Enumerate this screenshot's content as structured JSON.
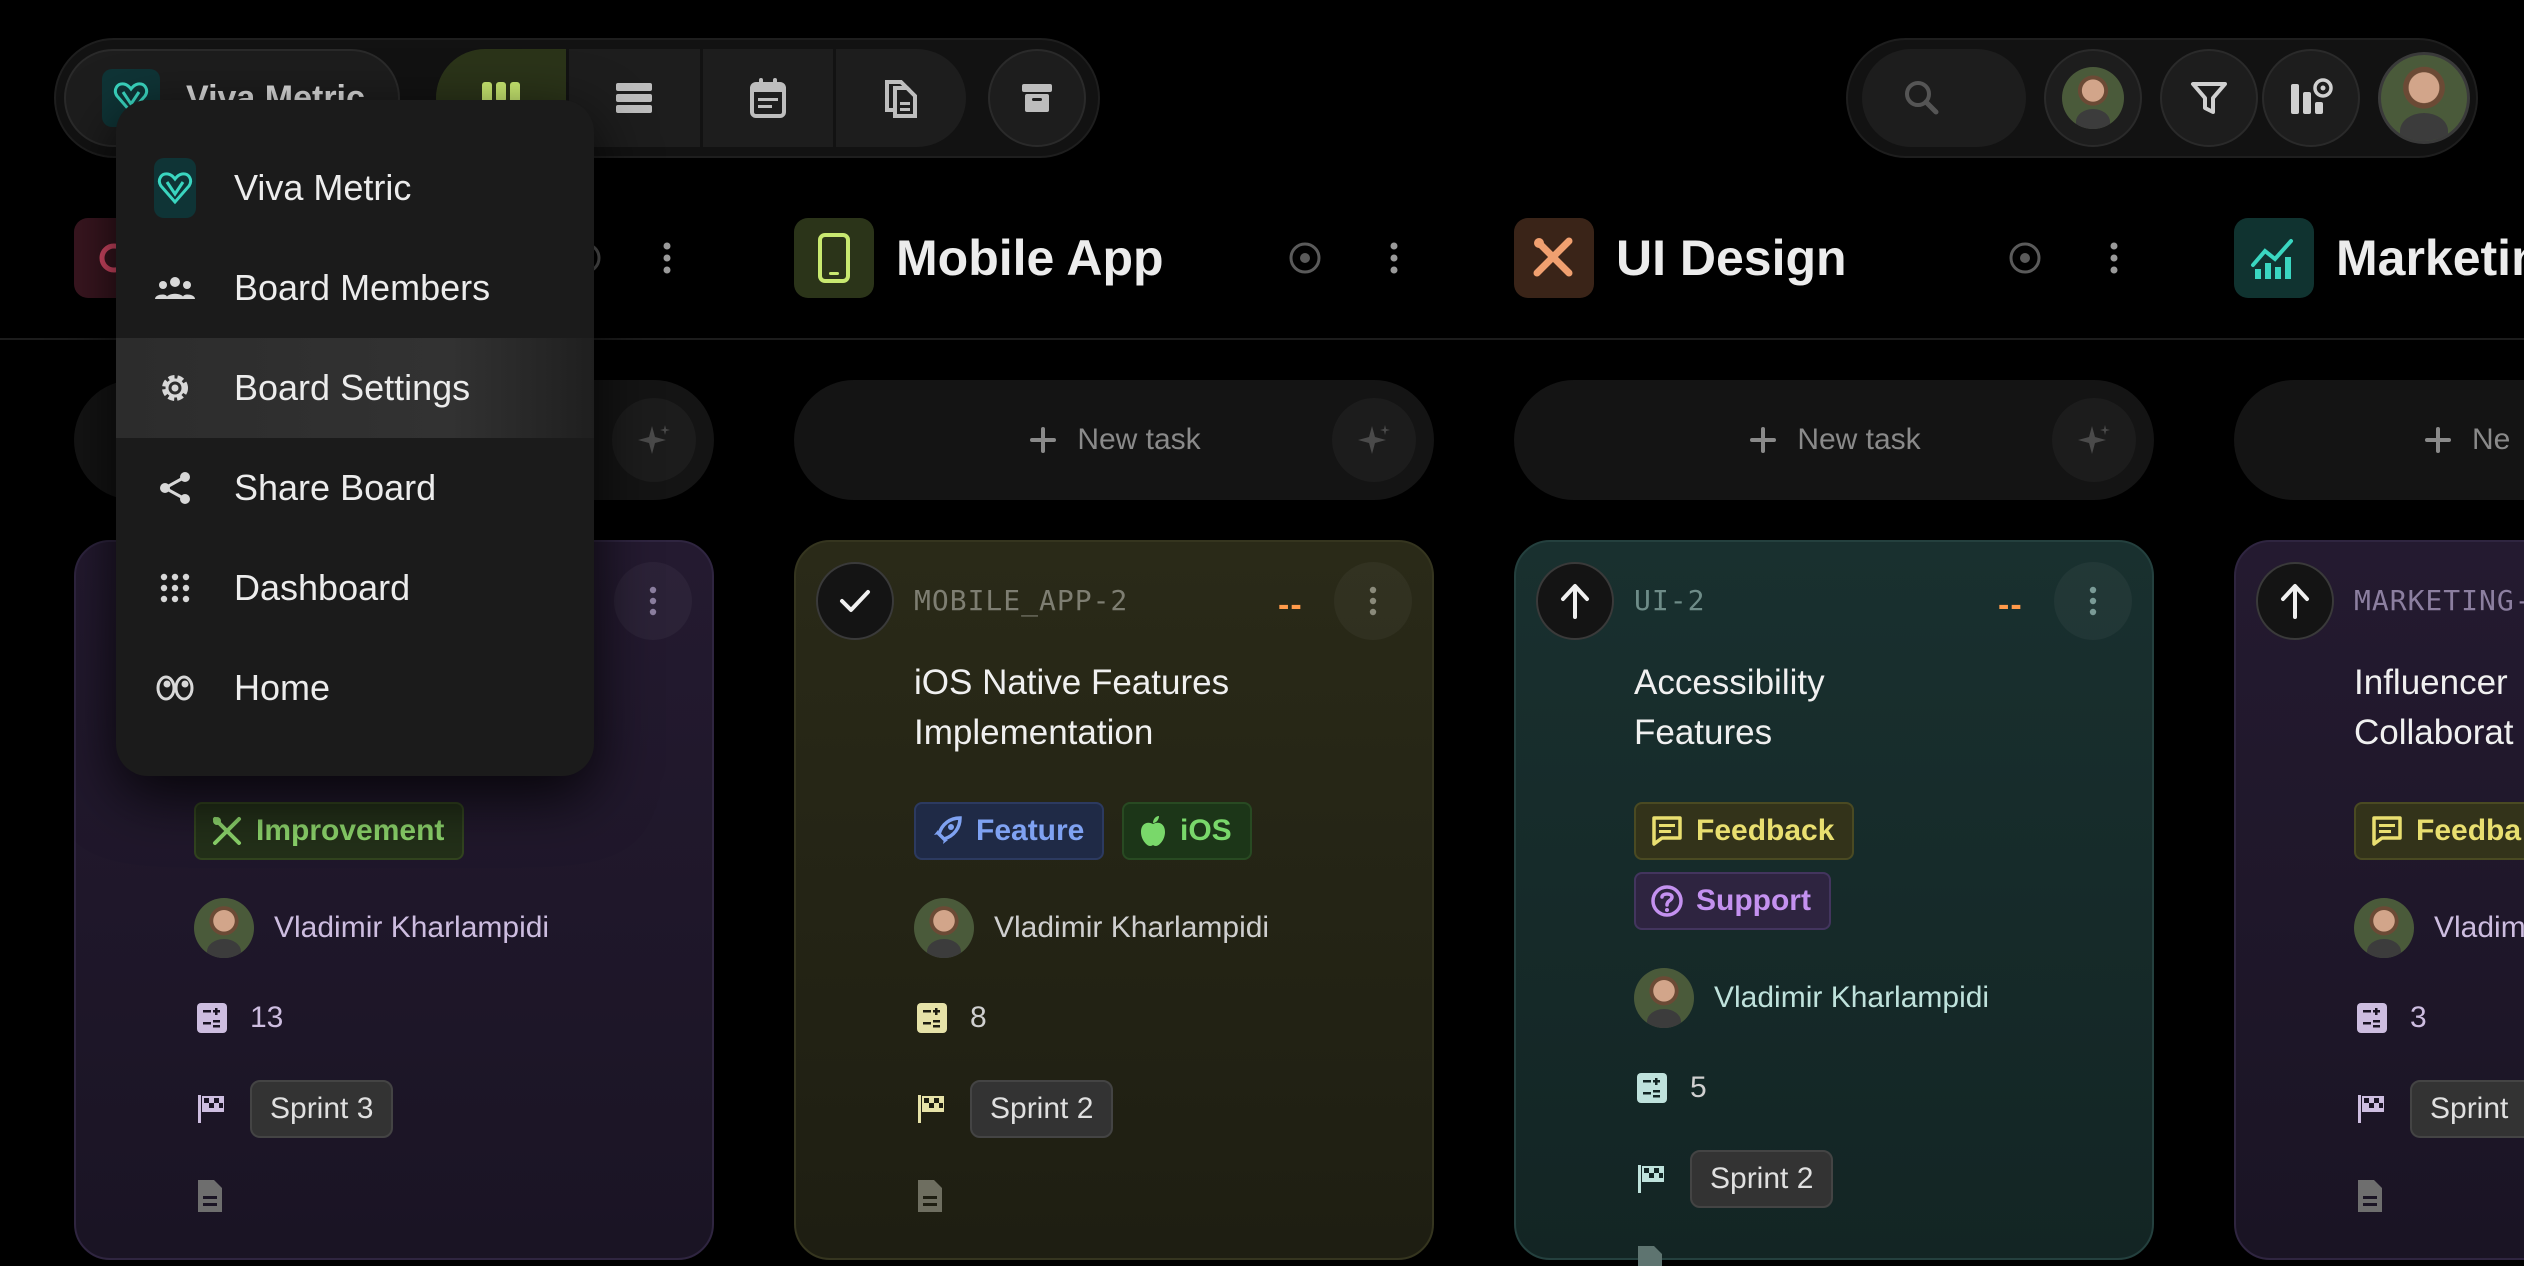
{
  "topbar": {
    "board_name": "Viva Metric",
    "views": [
      "kanban-view",
      "list-view",
      "calendar-view",
      "documents-view"
    ],
    "active_view": "kanban-view"
  },
  "menu": {
    "items": [
      {
        "label": "Viva Metric",
        "icon": "viva-logo-icon"
      },
      {
        "label": "Board Members",
        "icon": "members-icon"
      },
      {
        "label": "Board Settings",
        "icon": "gear-icon"
      },
      {
        "label": "Share Board",
        "icon": "share-icon"
      },
      {
        "label": "Dashboard",
        "icon": "dashboard-grid-icon"
      },
      {
        "label": "Home",
        "icon": "home-eyes-icon"
      }
    ],
    "hovered": "Board Settings"
  },
  "columns": [
    {
      "title": "",
      "icon": "gear-icon",
      "color": "#e14b6a"
    },
    {
      "title": "Mobile App",
      "icon": "phone-icon",
      "color": "#c8e870"
    },
    {
      "title": "UI Design",
      "icon": "design-tools-icon",
      "color": "#f0a070"
    },
    {
      "title": "Marketin",
      "icon": "chart-icon",
      "color": "#3ad6c0"
    }
  ],
  "new_task_label": "New task",
  "new_task_label_partial": "Ne",
  "cards": [
    {
      "column": 0,
      "tags": [
        "Improvement"
      ],
      "assignee": "Vladimir Kharlampidi",
      "estimate": "13",
      "sprint": "Sprint 3"
    },
    {
      "column": 1,
      "id": "MOBILE_APP-2",
      "priority": "--",
      "title_line1": "iOS Native Features",
      "title_line2": "Implementation",
      "tags": [
        "Feature",
        "iOS"
      ],
      "assignee": "Vladimir Kharlampidi",
      "estimate": "8",
      "sprint": "Sprint 2"
    },
    {
      "column": 2,
      "id": "UI-2",
      "priority": "--",
      "title_line1": "Accessibility",
      "title_line2": "Features",
      "tags": [
        "Feedback",
        "Support"
      ],
      "assignee": "Vladimir Kharlampidi",
      "estimate": "5",
      "sprint": "Sprint 2"
    },
    {
      "column": 3,
      "id": "MARKETING-",
      "title_line1": "Influencer",
      "title_line2": "Collaborat",
      "tags": [
        "Feedba"
      ],
      "assignee": "Vladim",
      "estimate": "3",
      "sprint": "Sprint"
    }
  ]
}
